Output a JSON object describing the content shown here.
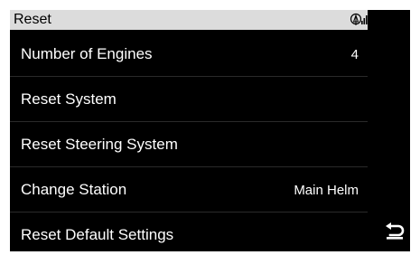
{
  "header": {
    "title": "Reset",
    "status_icon": "signal-antenna-icon"
  },
  "menu": {
    "items": [
      {
        "label": "Number of Engines",
        "value": "4"
      },
      {
        "label": "Reset System",
        "value": ""
      },
      {
        "label": "Reset Steering System",
        "value": ""
      },
      {
        "label": "Change Station",
        "value": "Main Helm"
      },
      {
        "label": "Reset Default Settings",
        "value": ""
      }
    ]
  },
  "nav": {
    "back_icon": "back-arrow-icon"
  },
  "colors": {
    "background": "#000000",
    "header": "#dcdcdc",
    "text": "#ffffff"
  }
}
